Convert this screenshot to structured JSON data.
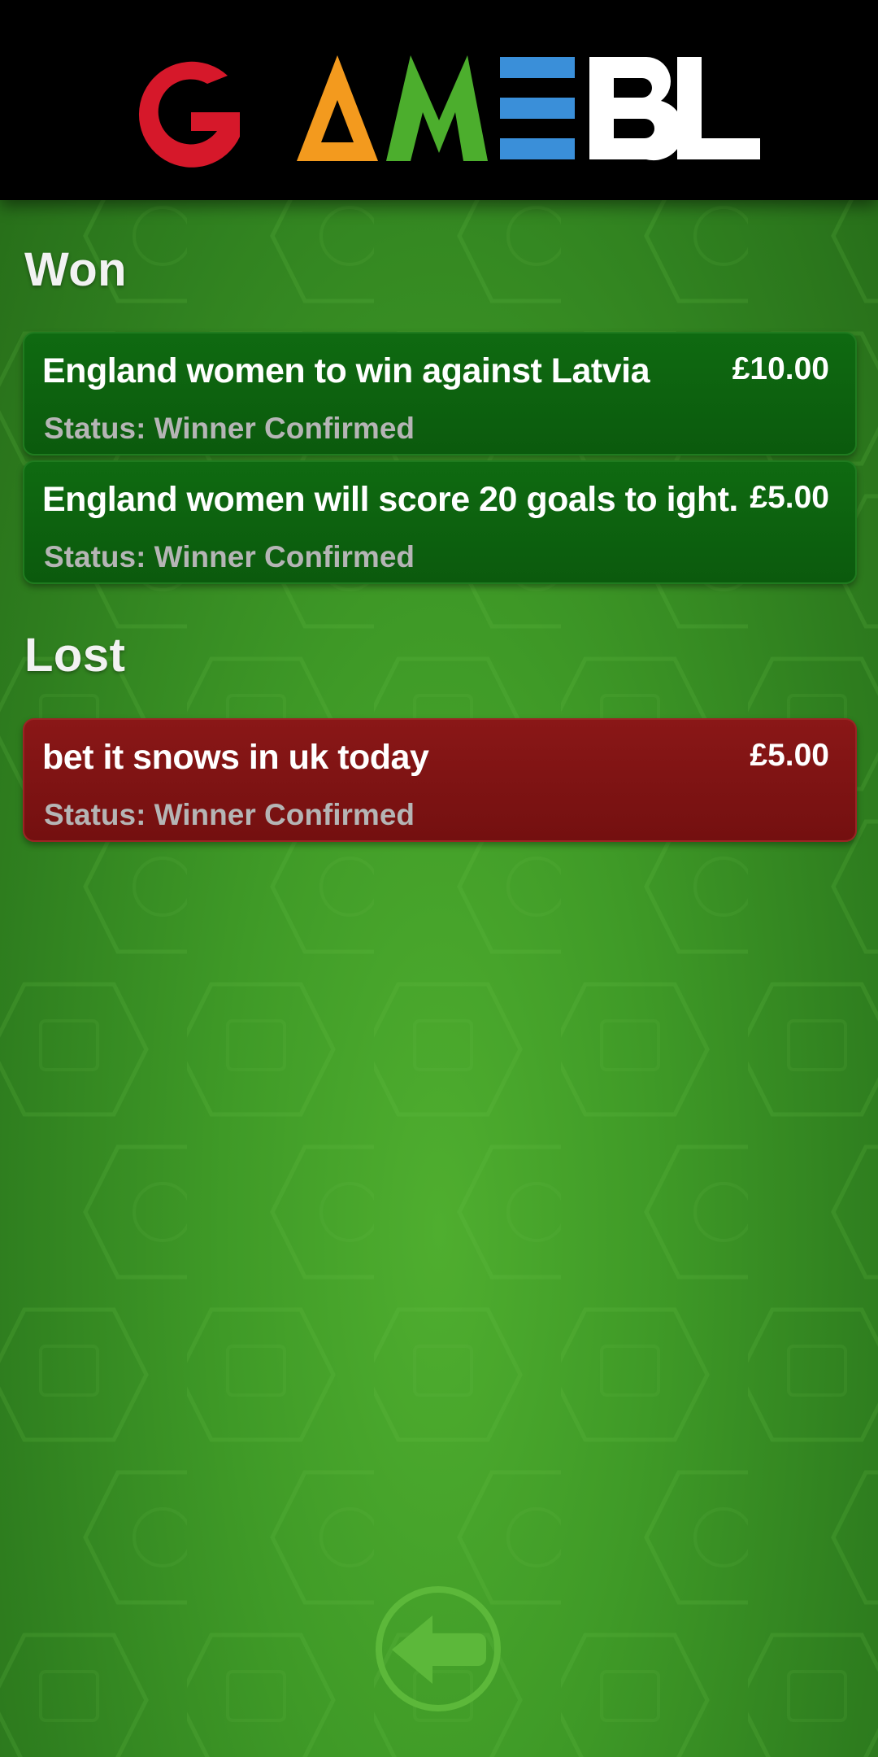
{
  "header": {
    "logo_text": "GAMEBL",
    "logo_colors": [
      "#d6182a",
      "#f39a1e",
      "#4cae2d",
      "#3a8fd9",
      "#ffffff",
      "#ffffff"
    ]
  },
  "sections": {
    "won": {
      "title": "Won",
      "bets": [
        {
          "title": "England women to win against Latvia",
          "amount": "£10.00",
          "status": "Status: Winner Confirmed"
        },
        {
          "title": "England women will score 20 goals to ight.",
          "amount": "£5.00",
          "status": "Status: Winner Confirmed"
        }
      ]
    },
    "lost": {
      "title": "Lost",
      "bets": [
        {
          "title": "bet it snows in uk today",
          "amount": "£5.00",
          "status": "Status: Winner Confirmed"
        }
      ]
    }
  },
  "navigation": {
    "back_icon": "back-arrow-icon"
  },
  "colors": {
    "won_card": "#0b5a0d",
    "lost_card": "#741010",
    "background": "#3f9a27",
    "header": "#000000"
  }
}
